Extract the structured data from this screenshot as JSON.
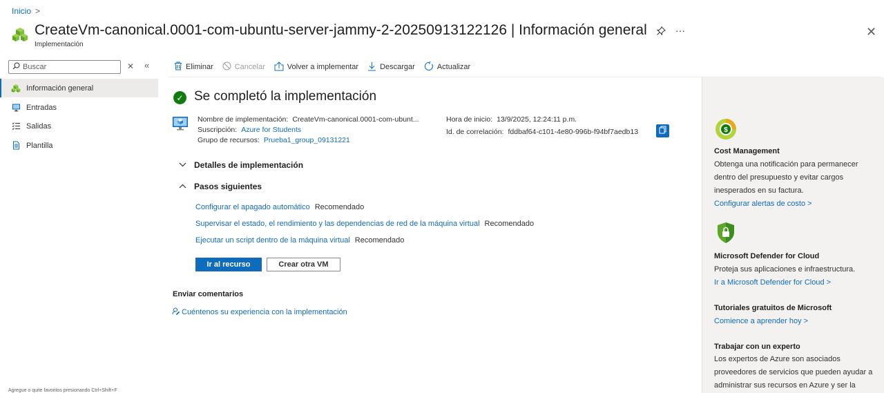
{
  "header": {
    "breadcrumb": "Inicio",
    "breadcrumb_sep": ">",
    "title": "CreateVm-canonical.0001-com-ubuntu-server-jammy-2-20250913122126 | Información general",
    "subtitle": "Implementación",
    "more_label": "···",
    "close_label": "✕"
  },
  "sidebar": {
    "search_placeholder": "Buscar",
    "clear_label": "✕",
    "collapse_label": "«",
    "items": [
      {
        "label": "Información general"
      },
      {
        "label": "Entradas"
      },
      {
        "label": "Salidas"
      },
      {
        "label": "Plantilla"
      }
    ],
    "footer": "Agregue o quite favoritos presionando Ctrl+Shift+F"
  },
  "toolbar": {
    "delete": "Eliminar",
    "cancel": "Cancelar",
    "redeploy": "Volver a implementar",
    "download": "Descargar",
    "refresh": "Actualizar"
  },
  "main": {
    "status_title": "Se completó la implementación",
    "deployment_name_label": "Nombre de implementación:",
    "deployment_name_value": "CreateVm-canonical.0001-com-ubunt...",
    "subscription_label": "Suscripción:",
    "subscription_value": "Azure for Students",
    "resource_group_label": "Grupo de recursos:",
    "resource_group_value": "Prueba1_group_09131221",
    "start_time_label": "Hora de inicio:",
    "start_time_value": "13/9/2025, 12:24:11 p.m.",
    "correlation_label": "Id. de correlación:",
    "correlation_value": "fddbaf64-c101-4e80-996b-f94bf7aedb13",
    "details_header": "Detalles de implementación",
    "next_steps_header": "Pasos siguientes",
    "steps": [
      {
        "link": "Configurar el apagado automático",
        "tag": "Recomendado"
      },
      {
        "link": "Supervisar el estado, el rendimiento y las dependencias de red de la máquina virtual",
        "tag": "Recomendado"
      },
      {
        "link": "Ejecutar un script dentro de la máquina virtual",
        "tag": "Recomendado"
      }
    ],
    "go_to_resource": "Ir al recurso",
    "create_another_vm": "Crear otra VM",
    "feedback_title": "Enviar comentarios",
    "feedback_link": "Cuéntenos su experiencia con la implementación"
  },
  "right_panel": {
    "cost_title": "Cost Management",
    "cost_text": "Obtenga una notificación para permanecer dentro del presupuesto y evitar cargos inesperados en su factura.",
    "cost_link": "Configurar alertas de costo >",
    "defender_title": "Microsoft Defender for Cloud",
    "defender_text": "Proteja sus aplicaciones e infraestructura.",
    "defender_link": "Ir a Microsoft Defender for Cloud >",
    "tutorials_title": "Tutoriales gratuitos de Microsoft",
    "tutorials_link": "Comience a aprender hoy >",
    "expert_title": "Trabajar con un experto",
    "expert_text": "Los expertos de Azure son asociados proveedores de servicios que pueden ayudar a administrar sus recursos en Azure y ser la"
  },
  "colors": {
    "accent": "#0f6cbd",
    "success": "#107c10",
    "panel_bg": "#f3f2f1"
  }
}
